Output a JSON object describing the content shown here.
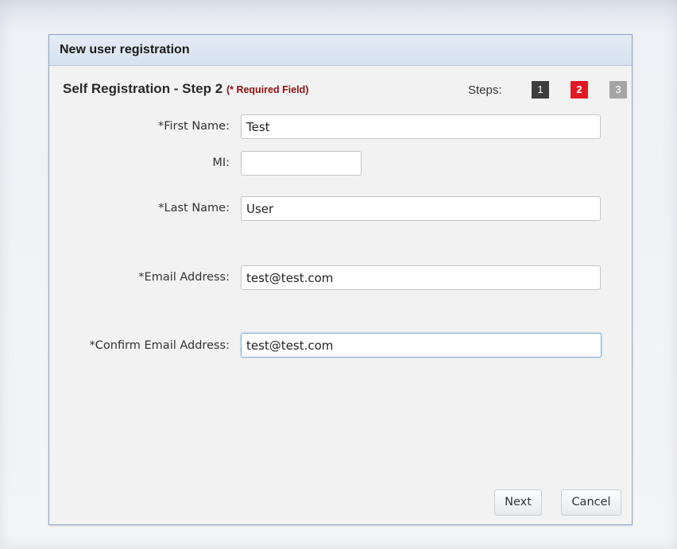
{
  "dialog": {
    "title": "New user registration"
  },
  "step_header": {
    "title": "Self Registration - Step 2",
    "required_note": "(* Required Field)",
    "steps_label": "Steps:",
    "steps": [
      "1",
      "2",
      "3"
    ],
    "current_step": "2"
  },
  "form": {
    "first_name": {
      "label": "*First Name:",
      "value": "Test"
    },
    "mi": {
      "label": "MI:",
      "value": ""
    },
    "last_name": {
      "label": "*Last Name:",
      "value": "User"
    },
    "email": {
      "label": "*Email Address:",
      "value": "test@test.com"
    },
    "confirm_email": {
      "label": "*Confirm Email Address:",
      "value": "test@test.com"
    }
  },
  "buttons": {
    "next": "Next",
    "cancel": "Cancel"
  },
  "colors": {
    "step_completed": "#3d3d3d",
    "step_current": "#e11a22",
    "step_pending": "#a5a5a5",
    "required_note": "#8a1010",
    "header_bg": "#dce6f1",
    "border": "#8fa6bf"
  }
}
